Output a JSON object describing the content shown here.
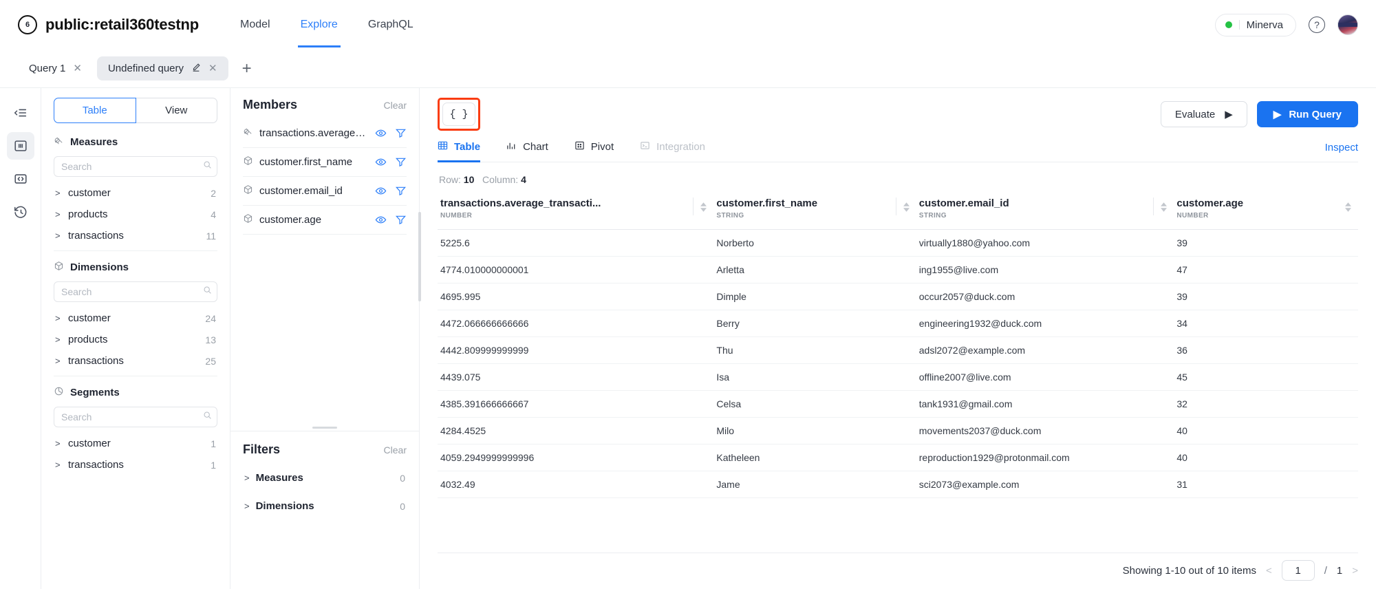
{
  "header": {
    "logo_icon": "circle-six-icon",
    "workspace_title": "public:retail360testnp",
    "nav": [
      {
        "label": "Model",
        "active": false
      },
      {
        "label": "Explore",
        "active": true
      },
      {
        "label": "GraphQL",
        "active": false
      }
    ],
    "env_badge": "Minerva",
    "help_icon": "question-mark-icon",
    "avatar_icon": "user-avatar"
  },
  "query_tabs": {
    "tabs": [
      {
        "label": "Query 1",
        "active": false
      },
      {
        "label": "Undefined query",
        "active": true
      }
    ],
    "add_label": "+"
  },
  "rail": {
    "items": [
      {
        "icon": "collapse-panel-icon",
        "active": false
      },
      {
        "icon": "columns-layout-icon",
        "active": true
      },
      {
        "icon": "code-brackets-icon",
        "active": false
      },
      {
        "icon": "history-clock-icon",
        "active": false
      }
    ]
  },
  "explorer": {
    "toggle": [
      {
        "label": "Table",
        "active": true
      },
      {
        "label": "View",
        "active": false
      }
    ],
    "groups": [
      {
        "title": "Measures",
        "icon": "measure-icon",
        "search_placeholder": "Search",
        "search_value": "",
        "cubes": [
          {
            "name": "customer",
            "count": "2"
          },
          {
            "name": "products",
            "count": "4"
          },
          {
            "name": "transactions",
            "count": "11"
          }
        ]
      },
      {
        "title": "Dimensions",
        "icon": "cube-icon",
        "search_placeholder": "Search",
        "search_value": "",
        "cubes": [
          {
            "name": "customer",
            "count": "24"
          },
          {
            "name": "products",
            "count": "13"
          },
          {
            "name": "transactions",
            "count": "25"
          }
        ]
      },
      {
        "title": "Segments",
        "icon": "segment-pie-icon",
        "search_placeholder": "Search",
        "search_value": "",
        "cubes": [
          {
            "name": "customer",
            "count": "1"
          },
          {
            "name": "transactions",
            "count": "1"
          }
        ]
      }
    ]
  },
  "members_panel": {
    "title": "Members",
    "clear_label": "Clear",
    "items": [
      {
        "name": "transactions.average_tra...",
        "icon": "measure-icon"
      },
      {
        "name": "customer.first_name",
        "icon": "cube-icon"
      },
      {
        "name": "customer.email_id",
        "icon": "cube-icon"
      },
      {
        "name": "customer.age",
        "icon": "cube-icon"
      }
    ]
  },
  "filters_panel": {
    "title": "Filters",
    "clear_label": "Clear",
    "rows": [
      {
        "label": "Measures",
        "count": "0"
      },
      {
        "label": "Dimensions",
        "count": "0"
      }
    ]
  },
  "toolbar": {
    "json_button_label": "{ }",
    "json_button_highlighted": true,
    "evaluate_label": "Evaluate",
    "run_query_label": "Run Query",
    "highlight_color": "#fa3c12",
    "primary_color": "#1a73f0"
  },
  "view_tabs": {
    "tabs": [
      {
        "label": "Table",
        "icon": "table-grid-icon",
        "active": true,
        "disabled": false
      },
      {
        "label": "Chart",
        "icon": "bar-chart-icon",
        "active": false,
        "disabled": false
      },
      {
        "label": "Pivot",
        "icon": "pivot-grid-icon",
        "active": false,
        "disabled": false
      },
      {
        "label": "Integration",
        "icon": "terminal-icon",
        "active": false,
        "disabled": true
      }
    ],
    "inspect_label": "Inspect"
  },
  "results": {
    "row_label": "Row:",
    "row_count": "10",
    "column_label": "Column:",
    "column_count": "4",
    "columns": [
      {
        "name": "transactions.average_transacti...",
        "type": "NUMBER"
      },
      {
        "name": "customer.first_name",
        "type": "STRING"
      },
      {
        "name": "customer.email_id",
        "type": "STRING"
      },
      {
        "name": "customer.age",
        "type": "NUMBER"
      }
    ],
    "rows": [
      [
        "5225.6",
        "Norberto",
        "virtually1880@yahoo.com",
        "39"
      ],
      [
        "4774.010000000001",
        "Arletta",
        "ing1955@live.com",
        "47"
      ],
      [
        "4695.995",
        "Dimple",
        "occur2057@duck.com",
        "39"
      ],
      [
        "4472.066666666666",
        "Berry",
        "engineering1932@duck.com",
        "34"
      ],
      [
        "4442.809999999999",
        "Thu",
        "adsl2072@example.com",
        "36"
      ],
      [
        "4439.075",
        "Isa",
        "offline2007@live.com",
        "45"
      ],
      [
        "4385.391666666667",
        "Celsa",
        "tank1931@gmail.com",
        "32"
      ],
      [
        "4284.4525",
        "Milo",
        "movements2037@duck.com",
        "40"
      ],
      [
        "4059.2949999999996",
        "Katheleen",
        "reproduction1929@protonmail.com",
        "40"
      ],
      [
        "4032.49",
        "Jame",
        "sci2073@example.com",
        "31"
      ]
    ],
    "footer": {
      "showing_text": "Showing 1-10 out of 10 items",
      "page_value": "1",
      "page_separator": "/",
      "total_pages": "1",
      "prev_icon": "chevron-left-icon",
      "next_icon": "chevron-right-icon"
    }
  }
}
